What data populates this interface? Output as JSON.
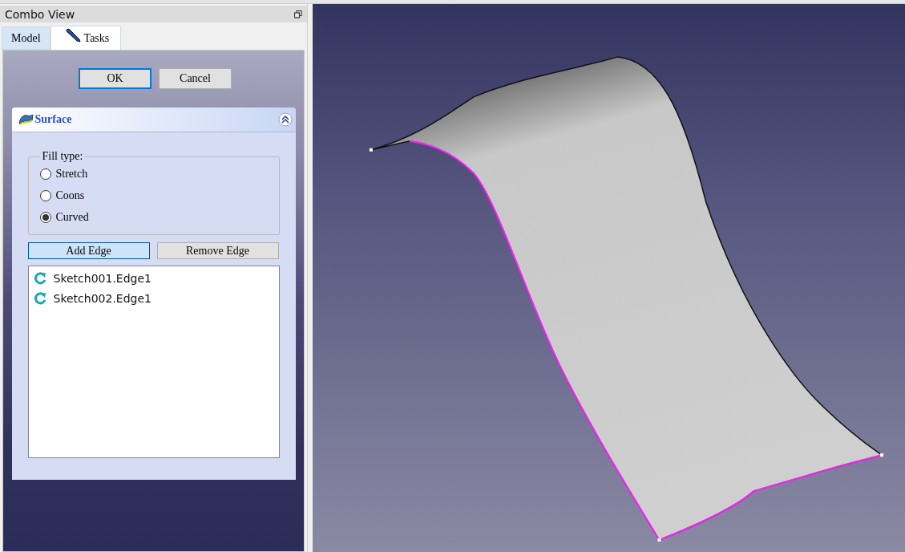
{
  "panel": {
    "title": "Combo View"
  },
  "tabs": [
    {
      "label": "Model",
      "selected": false
    },
    {
      "label": "Tasks",
      "selected": true
    }
  ],
  "buttons": [
    {
      "label": "OK",
      "focused": true
    },
    {
      "label": "Cancel",
      "focused": false
    }
  ],
  "task_box": {
    "title": "Surface",
    "expanded": true
  },
  "fill_type": {
    "label": "Fill type:",
    "options": [
      {
        "label": "Stretch",
        "selected": false
      },
      {
        "label": "Coons",
        "selected": false
      },
      {
        "label": "Curved",
        "selected": true
      }
    ]
  },
  "edge_buttons": [
    {
      "label": "Add Edge",
      "checked": true
    },
    {
      "label": "Remove Edge",
      "checked": false
    }
  ],
  "edges": [
    "Sketch001.Edge1",
    "Sketch002.Edge1"
  ]
}
